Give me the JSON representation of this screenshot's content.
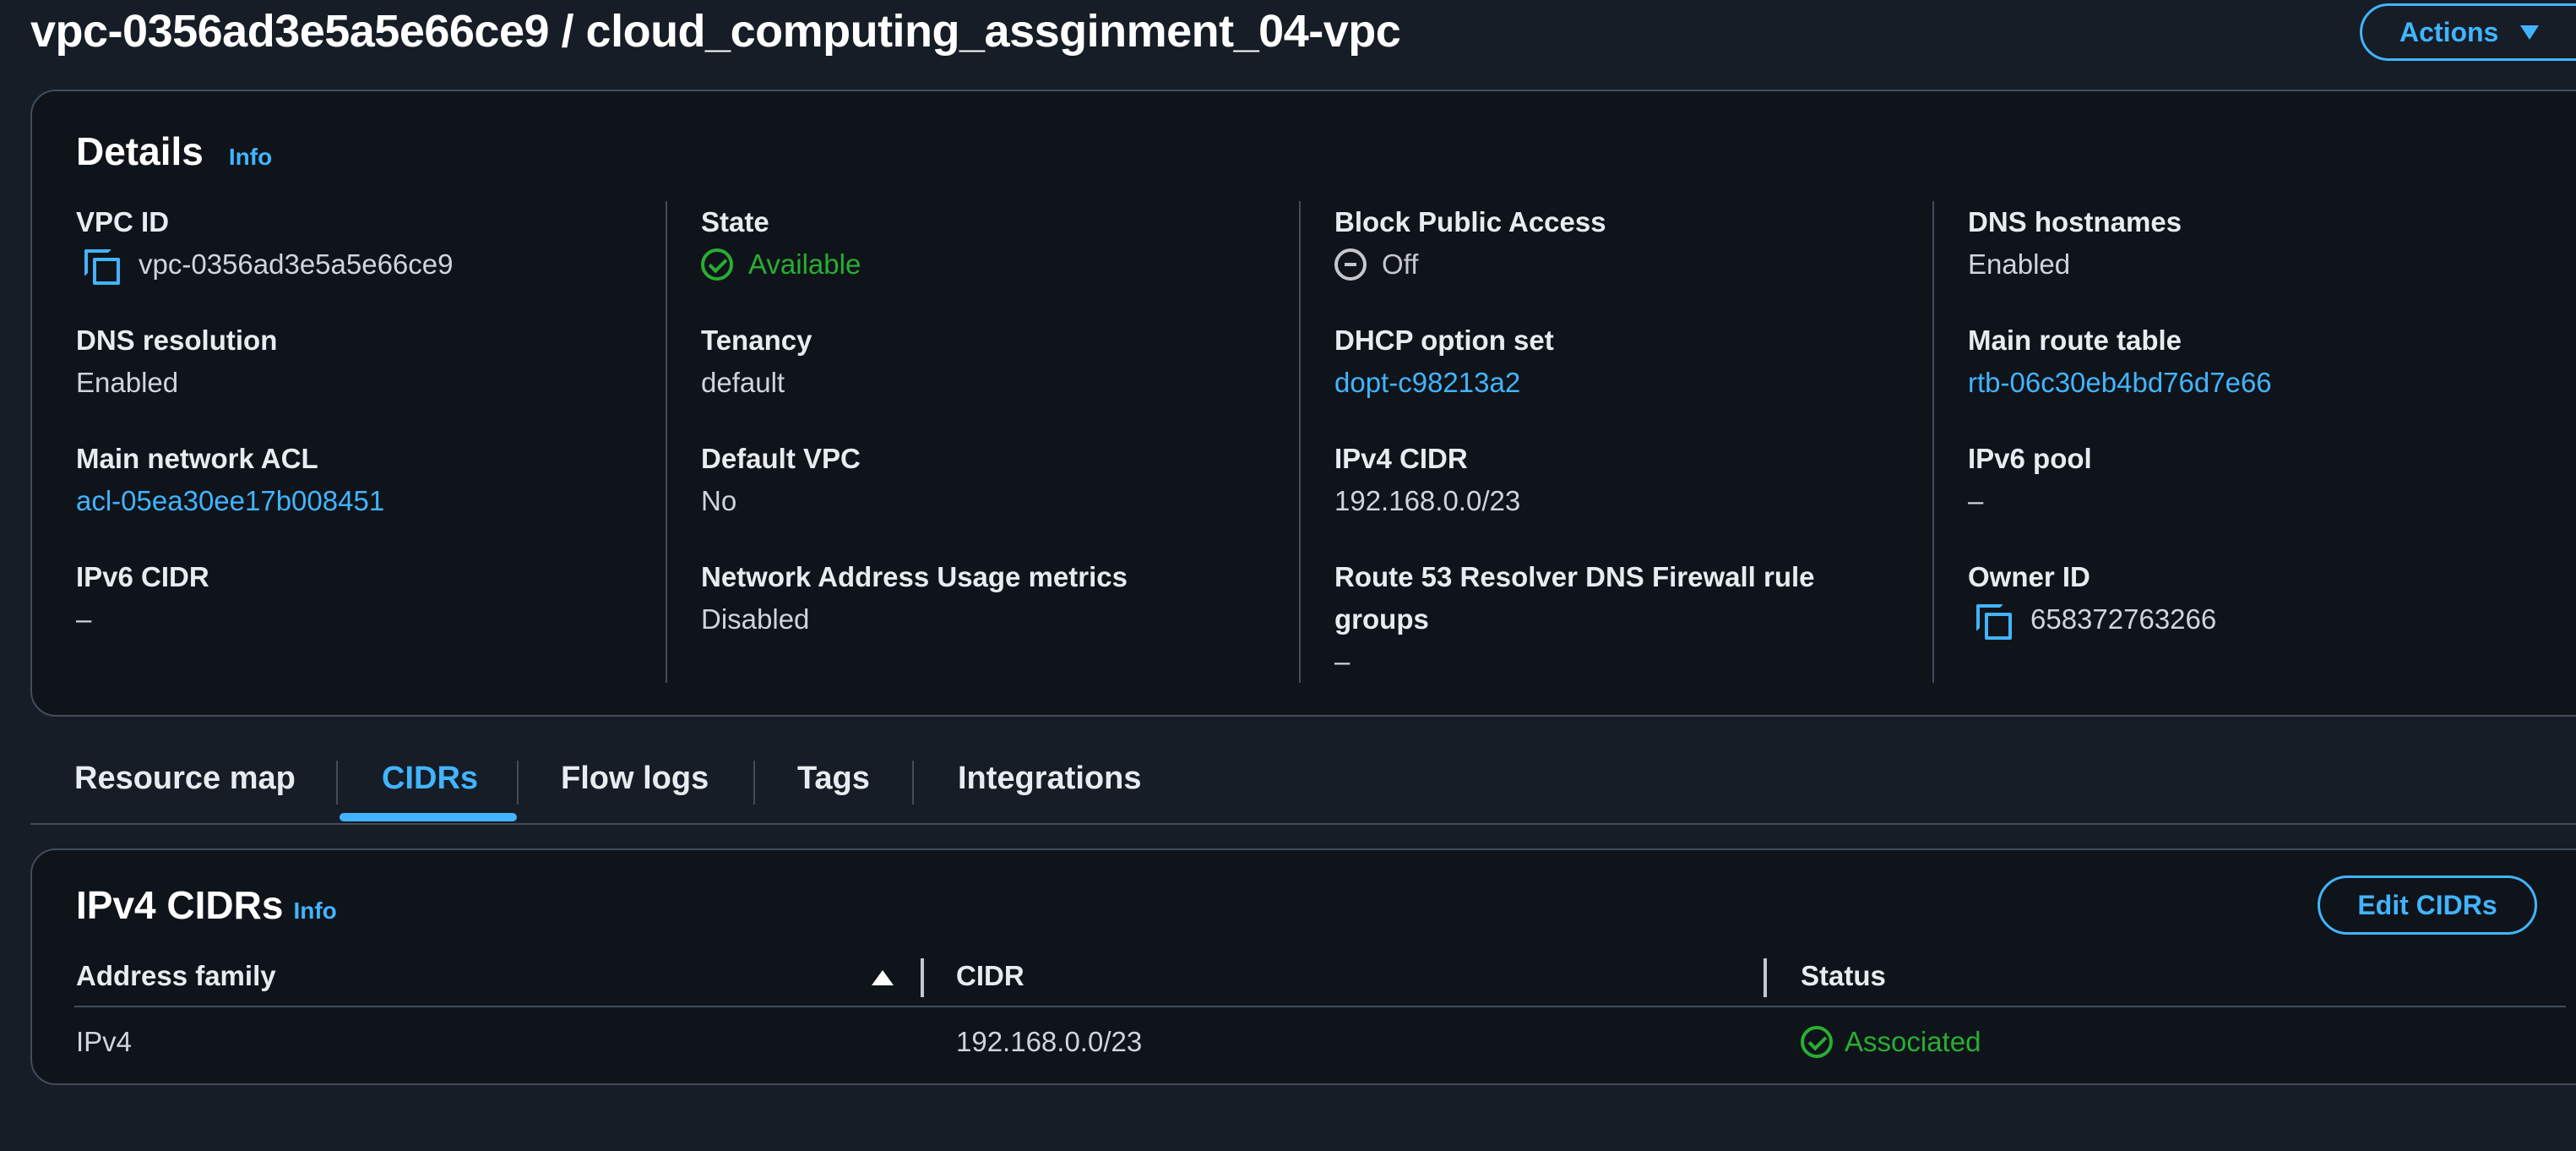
{
  "header": {
    "title": "vpc-0356ad3e5a5e66ce9 / cloud_computing_assginment_04-vpc",
    "actions_label": "Actions"
  },
  "details": {
    "heading": "Details",
    "info_label": "Info",
    "columns": [
      [
        {
          "label": "VPC ID",
          "value": "vpc-0356ad3e5a5e66ce9"
        },
        {
          "label": "DNS resolution",
          "value": "Enabled"
        },
        {
          "label": "Main network ACL",
          "value": "acl-05ea30ee17b008451"
        },
        {
          "label": "IPv6 CIDR",
          "value": "–"
        }
      ],
      [
        {
          "label": "State",
          "value": "Available"
        },
        {
          "label": "Tenancy",
          "value": "default"
        },
        {
          "label": "Default VPC",
          "value": "No"
        },
        {
          "label": "Network Address Usage metrics",
          "value": "Disabled"
        }
      ],
      [
        {
          "label": "Block Public Access",
          "value": "Off"
        },
        {
          "label": "DHCP option set",
          "value": "dopt-c98213a2"
        },
        {
          "label": "IPv4 CIDR",
          "value": "192.168.0.0/23"
        },
        {
          "label": "Route 53 Resolver DNS Firewall rule groups",
          "value": "–"
        }
      ],
      [
        {
          "label": "DNS hostnames",
          "value": "Enabled"
        },
        {
          "label": "Main route table",
          "value": "rtb-06c30eb4bd76d7e66"
        },
        {
          "label": "IPv6 pool",
          "value": "–"
        },
        {
          "label": "Owner ID",
          "value": "658372763266"
        }
      ]
    ]
  },
  "tabs": [
    {
      "label": "Resource map"
    },
    {
      "label": "CIDRs"
    },
    {
      "label": "Flow logs"
    },
    {
      "label": "Tags"
    },
    {
      "label": "Integrations"
    }
  ],
  "cidrs": {
    "title": "IPv4 CIDRs",
    "info_label": "Info",
    "edit_label": "Edit CIDRs",
    "columns": [
      "Address family",
      "CIDR",
      "Status"
    ],
    "rows": [
      {
        "family": "IPv4",
        "cidr": "192.168.0.0/23",
        "status": "Associated"
      }
    ]
  },
  "colors": {
    "background": "#161d26",
    "accent": "#42b4ff",
    "success": "#29ad32",
    "border": "#414d5c"
  }
}
